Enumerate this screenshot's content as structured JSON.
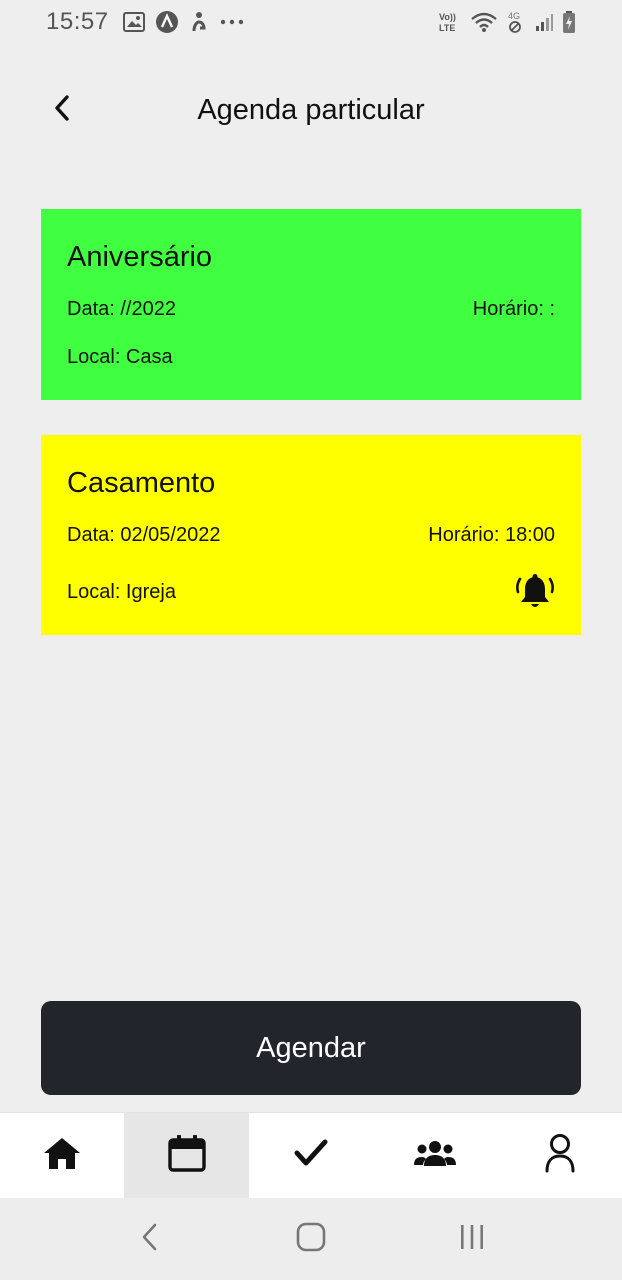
{
  "status_bar": {
    "time": "15:57",
    "left_icons": [
      "image-icon",
      "app-badge-icon",
      "accessibility-icon",
      "more-dots-icon"
    ],
    "right_icons": [
      "volte-icon",
      "wifi-icon",
      "mobile-data-4g-icon",
      "signal-icon",
      "battery-charging-icon"
    ],
    "volte_label": "Vo))\nLTE",
    "data_label": "4G"
  },
  "header": {
    "title": "Agenda particular",
    "back_icon": "chevron-left-icon"
  },
  "events": [
    {
      "title": "Aniversário",
      "date_text": "Data: //2022",
      "time_text": "Horário: :",
      "local_text": "Local: Casa",
      "color": "#40ff40",
      "has_alarm": false
    },
    {
      "title": "Casamento",
      "date_text": "Data: 02/05/2022",
      "time_text": "Horário: 18:00",
      "local_text": "Local: Igreja",
      "color": "#ffff00",
      "has_alarm": true,
      "alarm_icon": "bell-ringing-icon"
    }
  ],
  "agendar_button": {
    "label": "Agendar",
    "color": "#22252b"
  },
  "bottom_nav": {
    "items": [
      {
        "icon": "home-icon",
        "active": false
      },
      {
        "icon": "calendar-icon",
        "active": true
      },
      {
        "icon": "checkmark-icon",
        "active": false
      },
      {
        "icon": "users-group-icon",
        "active": false
      },
      {
        "icon": "user-profile-icon",
        "active": false
      }
    ]
  },
  "system_nav": {
    "items": [
      "back-nav-icon",
      "home-nav-icon",
      "recents-nav-icon"
    ]
  }
}
